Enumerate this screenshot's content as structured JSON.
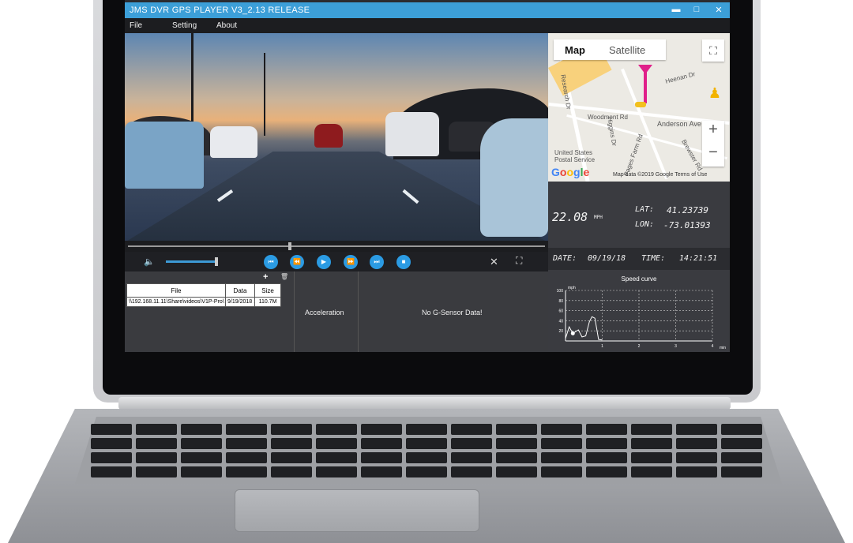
{
  "window": {
    "title": "JMS DVR GPS PLAYER V3_2.13 RELEASE",
    "minimize": "▬",
    "maximize": "□",
    "close": "✕"
  },
  "menu": [
    "File",
    "Setting",
    "About"
  ],
  "map": {
    "tab_map": "Map",
    "tab_satellite": "Satellite",
    "zoom_in": "+",
    "zoom_out": "−",
    "labels": {
      "woodmont": "Woodmont Rd",
      "anderson": "Anderson Ave",
      "postal": "United States\nPostal Service",
      "heenan": "Heenan Dr",
      "research": "Research Dr",
      "higgins": "Higgins Dr",
      "pages": "Pages Farm Rd",
      "brewster": "Brewster Rd"
    },
    "logo": "Google",
    "attribution": "Map data ©2019 Google   Terms of Use"
  },
  "gps": {
    "speed": "22.08",
    "speed_unit": "MPH",
    "lat_label": "LAT:",
    "lat": "41.23739",
    "lon_label": "LON:",
    "lon": "-73.01393",
    "date_label": "DATE:",
    "date": "09/19/18",
    "time_label": "TIME:",
    "time": "14:21:51"
  },
  "table": {
    "headers": [
      "File",
      "Data",
      "Size"
    ],
    "rows": [
      [
        "\\\\192.168.11.11\\Share\\videos\\V1P-Pro\\",
        "9/19/2018 1",
        "110.7M"
      ]
    ],
    "add": "+",
    "delete": "🗑"
  },
  "acceleration_label": "Acceleration",
  "gsensor_text": "No G-Sensor Data!",
  "colors": {
    "accent": "#3c9fd8",
    "button": "#2b9be3",
    "route": "#e0208a"
  },
  "speed_curve": {
    "chart_data": {
      "type": "line",
      "title": "Speed curve",
      "ylabel": "mph",
      "xlabel": "min",
      "y_ticks": [
        "100",
        "80",
        "60",
        "40",
        "20"
      ],
      "x_ticks": [
        "1",
        "2",
        "3",
        "4"
      ],
      "ylim": [
        0,
        100
      ],
      "xlim": [
        0,
        4
      ],
      "series": [
        {
          "x": [
            0.0,
            0.1,
            0.2,
            0.35,
            0.45,
            0.55,
            0.65,
            0.72,
            0.8,
            0.9,
            1.0
          ],
          "y": [
            5,
            28,
            15,
            22,
            8,
            10,
            38,
            48,
            45,
            3,
            2
          ]
        }
      ]
    }
  }
}
